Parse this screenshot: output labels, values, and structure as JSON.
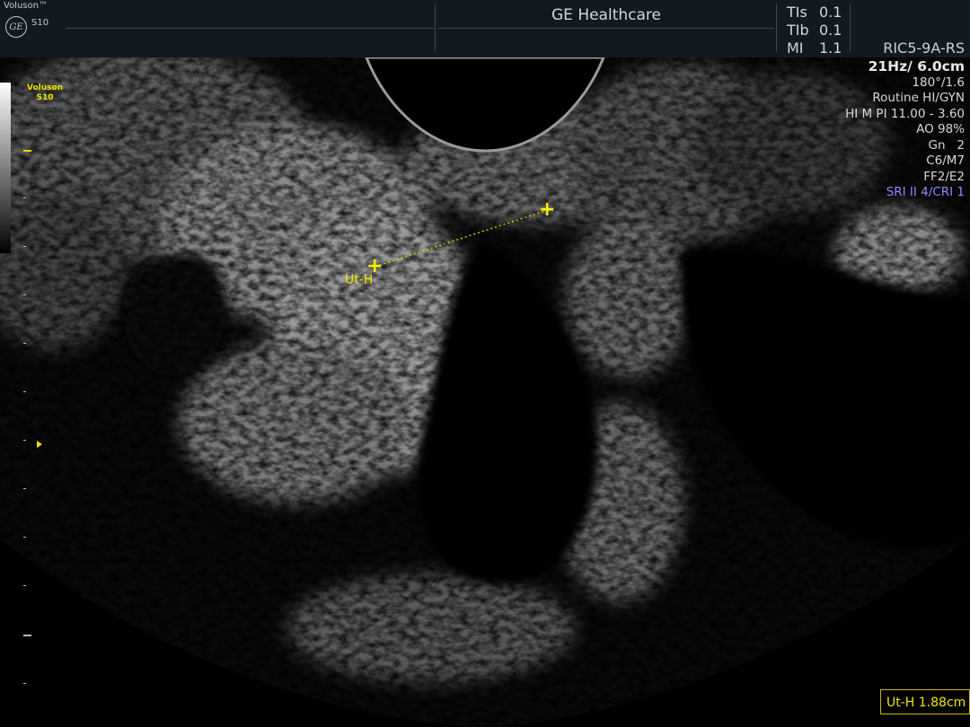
{
  "header": {
    "brand": "Voluson™",
    "logo_text": "GE",
    "model": "S10",
    "manufacturer": "GE Healthcare",
    "indices": [
      {
        "label": "TIs",
        "value": "0.1"
      },
      {
        "label": "TIb",
        "value": "0.1"
      },
      {
        "label": "MI",
        "value": "1.1"
      }
    ],
    "probe": "RIC5-9A-RS"
  },
  "params": {
    "frame_depth": "21Hz/ 6.0cm",
    "lines": [
      "180°/1.6",
      "Routine HI/GYN",
      "HI M PI 11.00 - 3.60",
      "AO 98%",
      "Gn   2",
      "C6/M7",
      "FF2/E2"
    ],
    "sri": "SRI II 4/CRI 1"
  },
  "graybar": {
    "label_line1": "Voluson",
    "label_line2": "S10"
  },
  "caliper": {
    "label": "Ut-H",
    "measurement": "Ut-H 1.88cm",
    "color": "#f2e600"
  },
  "icons": [
    "ge-logo-icon",
    "caliper-cross-icon",
    "focus-marker-icon"
  ]
}
